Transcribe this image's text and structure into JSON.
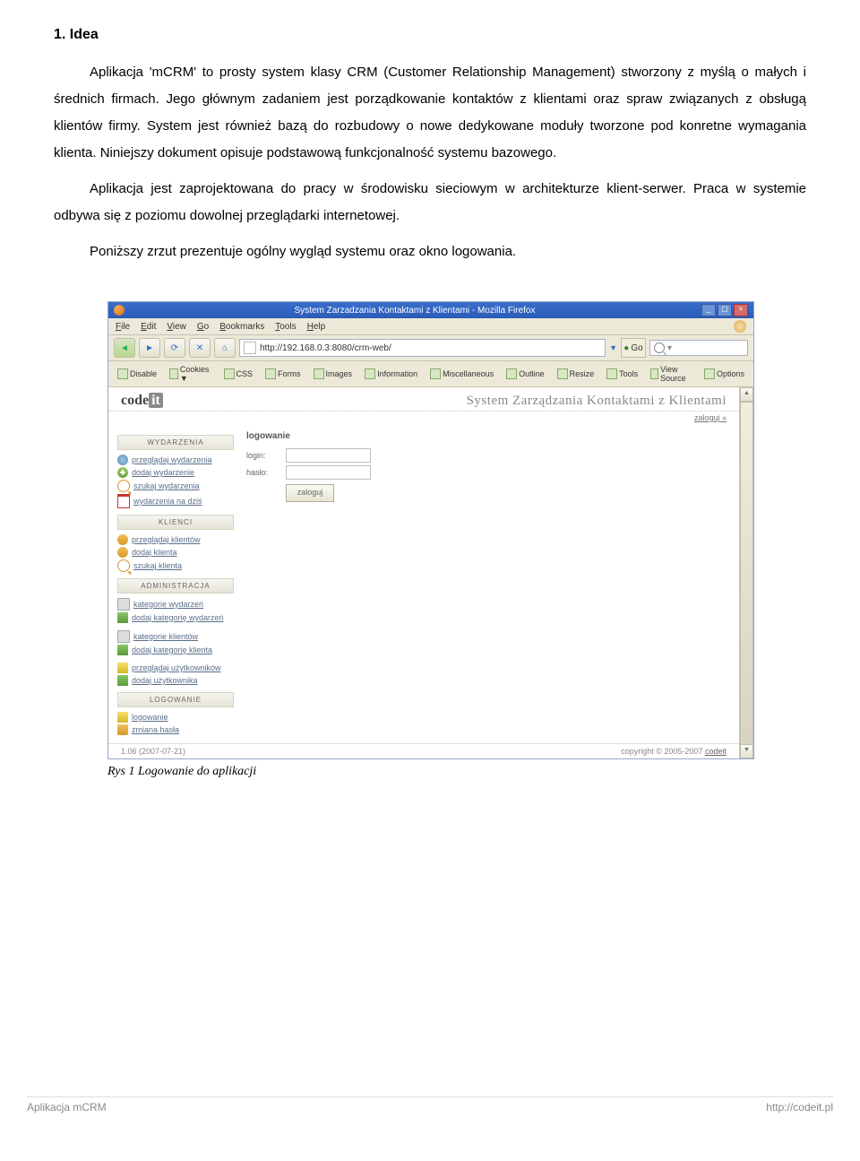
{
  "heading": "1. Idea",
  "para1": "Aplikacja 'mCRM' to prosty system klasy CRM (Customer Relationship Management) stworzony z myślą o małych i średnich firmach. Jego głównym zadaniem jest porządkowanie kontaktów z klientami oraz spraw związanych z obsługą klientów firmy. System jest również bazą do rozbudowy o nowe dedykowane moduły tworzone pod konretne wymagania klienta. Niniejszy dokument opisuje podstawową funkcjonalność systemu bazowego.",
  "para2": "Aplikacja jest zaprojektowana do pracy w środowisku sieciowym w architekturze klient-serwer. Praca w systemie odbywa się z poziomu dowolnej przeglądarki internetowej.",
  "para3": "Poniższy zrzut prezentuje ogólny wygląd systemu oraz okno logowania.",
  "caption": "Rys 1 Logowanie do aplikacji",
  "footer_left": "Aplikacja mCRM",
  "footer_right": "http://codeit.pl",
  "shot": {
    "title": "System Zarzadzania Kontaktami z Klientami - Mozilla Firefox",
    "menu": [
      "File",
      "Edit",
      "View",
      "Go",
      "Bookmarks",
      "Tools",
      "Help"
    ],
    "url": "http://192.168.0.3:8080/crm-web/",
    "go": "Go",
    "webdev": [
      "Disable",
      "Cookies ▼",
      "CSS",
      "Forms",
      "Images",
      "Information",
      "Miscellaneous",
      "Outline",
      "Resize",
      "Tools",
      "View Source",
      "Options"
    ],
    "brand_name": "code",
    "brand_it": "it",
    "brand_slogan": "System Zarządzania Kontaktami z Klientami",
    "zaloguj": "zaloguj »",
    "sidebar": {
      "wydarzenia": {
        "head": "WYDARZENIA",
        "items": [
          "przeglądaj wydarzenia",
          "dodaj wydarzenie",
          "szukaj wydarzenia",
          "wydarzenia na dziś"
        ]
      },
      "klienci": {
        "head": "KLIENCI",
        "items": [
          "przeglądaj klientów",
          "dodaj klienta",
          "szukaj klienta"
        ]
      },
      "admin": {
        "head": "ADMINISTRACJA",
        "items": [
          "kategorie wydarzeń",
          "dodaj kategorię wydarzeń",
          "kategorie klientów",
          "dodaj kategorię klienta",
          "przeglądaj użytkowników",
          "dodaj użytkownika"
        ]
      },
      "logowanie": {
        "head": "LOGOWANIE",
        "items": [
          "logowanie",
          "zmiana hasła"
        ]
      }
    },
    "panel": {
      "title": "logowanie",
      "login_label": "login:",
      "haslo_label": "hasło:",
      "button": "zaloguj"
    },
    "status_left": "1.06 (2007-07-21)",
    "status_right_prefix": "copyright © 2005-2007 ",
    "status_right_link": "codeit"
  }
}
